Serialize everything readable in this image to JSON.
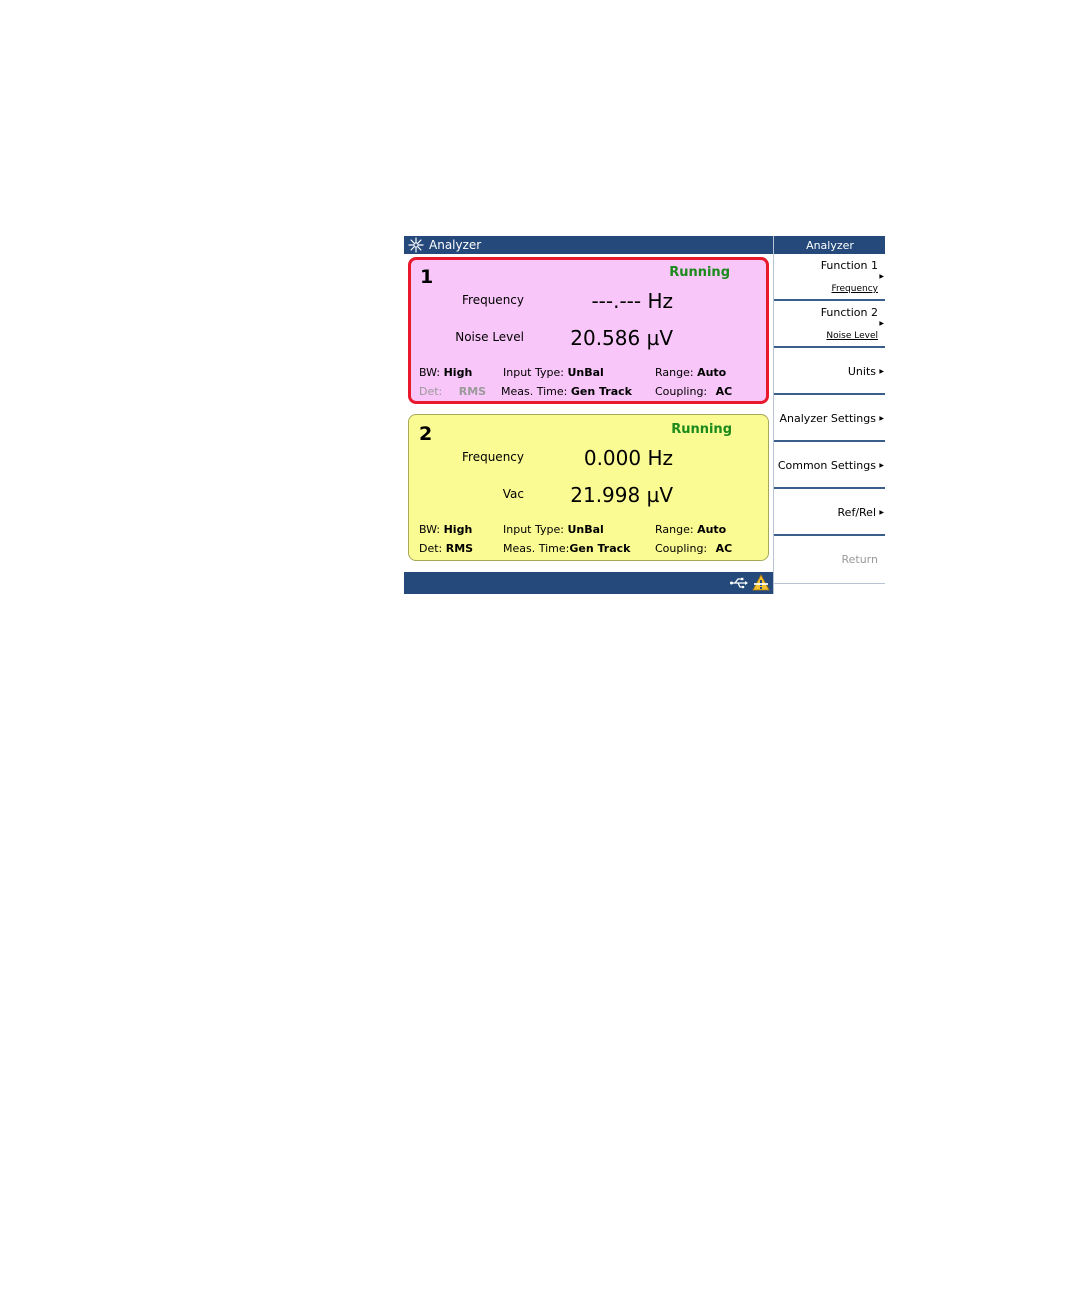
{
  "window": {
    "title": "Analyzer"
  },
  "softkeys": {
    "title": "Analyzer",
    "items": [
      {
        "label": "Function 1",
        "sub": "Frequency"
      },
      {
        "label": "Function 2",
        "sub": "Noise Level"
      },
      {
        "label": "Units"
      },
      {
        "label": "Analyzer Settings"
      },
      {
        "label": "Common Settings"
      },
      {
        "label": "Ref/Rel"
      },
      {
        "label": "Return"
      }
    ]
  },
  "channels": [
    {
      "number": "1",
      "status": "Running",
      "func1": {
        "label": "Frequency",
        "value": "---.--- Hz"
      },
      "func2": {
        "label": "Noise Level",
        "value": "20.586 µV"
      },
      "bw": {
        "label": "BW:",
        "value": "High"
      },
      "det": {
        "label": "Det:",
        "value": "RMS"
      },
      "input_type": {
        "label": "Input Type:",
        "value": "UnBal"
      },
      "meas_time": {
        "label": "Meas. Time:",
        "value": "Gen Track"
      },
      "range": {
        "label": "Range:",
        "value": "Auto"
      },
      "coupling": {
        "label": "Coupling:",
        "value": "AC"
      }
    },
    {
      "number": "2",
      "status": "Running",
      "func1": {
        "label": "Frequency",
        "value": "0.000 Hz"
      },
      "func2": {
        "label": "Vac",
        "value": "21.998 µV"
      },
      "bw": {
        "label": "BW:",
        "value": "High"
      },
      "det": {
        "label": "Det:",
        "value": "RMS"
      },
      "input_type": {
        "label": "Input Type:",
        "value": "UnBal"
      },
      "meas_time": {
        "label": "Meas. Time:",
        "value": "Gen Track"
      },
      "range": {
        "label": "Range:",
        "value": "Auto"
      },
      "coupling": {
        "label": "Coupling:",
        "value": "AC"
      }
    }
  ],
  "colors": {
    "title_bar": "#24497a",
    "channel1_bg": "#f8c6f8",
    "channel1_border": "#e8192c",
    "channel2_bg": "#fbfb94",
    "running": "#1b8a1b"
  },
  "icons": {
    "logo": "agilent-spark-icon",
    "usb": "usb-icon",
    "warning": "warning-icon"
  }
}
